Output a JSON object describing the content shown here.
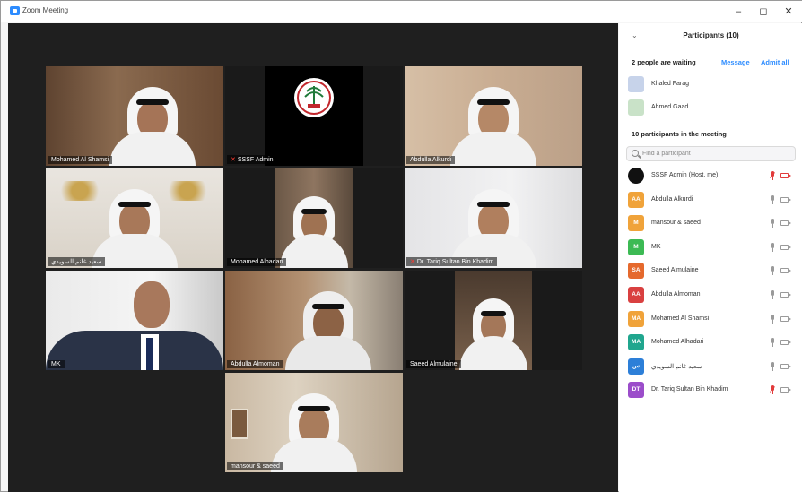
{
  "window": {
    "title": "Zoom Meeting",
    "minimize": "–",
    "restore": "◻",
    "close": "✕"
  },
  "gallery": {
    "tiles": [
      {
        "name": "Mohamed Al Shamsi",
        "mic_muted": false
      },
      {
        "name": "SSSF Admin",
        "mic_muted": true
      },
      {
        "name": "Abdulla Alkurdi",
        "mic_muted": false,
        "active_speaker": true
      },
      {
        "name": "سعيد غانم السويدي",
        "mic_muted": false
      },
      {
        "name": "Mohamed Alhadari",
        "mic_muted": false
      },
      {
        "name": "Dr. Tariq Sultan Bin Khadim",
        "mic_muted": true
      },
      {
        "name": "MK",
        "mic_muted": false
      },
      {
        "name": "Abdulla Almoman",
        "mic_muted": false
      },
      {
        "name": "Saeed Almulaine",
        "mic_muted": false
      },
      {
        "name": "mansour & saeed",
        "mic_muted": false
      }
    ]
  },
  "participants_panel": {
    "title": "Participants (10)",
    "waiting_label": "2 people are waiting",
    "message_label": "Message",
    "admit_all_label": "Admit all",
    "waiting": [
      {
        "name": "Khaled Farag",
        "initials": "KF",
        "color": "#c7d3ea"
      },
      {
        "name": "Ahmed Gaad",
        "initials": "AG",
        "color": "#c9e2c8"
      }
    ],
    "in_meeting_label": "10 participants in the meeting",
    "search_placeholder": "Find a participant",
    "participants": [
      {
        "name": "SSSF Admin (Host, me)",
        "initials": "",
        "color": "#111111",
        "mic": "muted",
        "video": "off"
      },
      {
        "name": "Abdulla Alkurdi",
        "initials": "AA",
        "color": "#f0a33a",
        "mic": "on",
        "video": "on"
      },
      {
        "name": "mansour & saeed",
        "initials": "M",
        "color": "#f0a33a",
        "mic": "on",
        "video": "on"
      },
      {
        "name": "MK",
        "initials": "M",
        "color": "#3cba54",
        "mic": "on",
        "video": "on"
      },
      {
        "name": "Saeed Almulaine",
        "initials": "SA",
        "color": "#e5692d",
        "mic": "on",
        "video": "on"
      },
      {
        "name": "Abdulla Almoman",
        "initials": "AA",
        "color": "#d94040",
        "mic": "on",
        "video": "on"
      },
      {
        "name": "Mohamed Al Shamsi",
        "initials": "MA",
        "color": "#f0a33a",
        "mic": "on",
        "video": "on"
      },
      {
        "name": "Mohamed Alhadari",
        "initials": "MA",
        "color": "#20a68e",
        "mic": "on",
        "video": "on"
      },
      {
        "name": "سعيد غانم السويدي",
        "initials": "س",
        "color": "#2d7fd8",
        "mic": "on",
        "video": "on"
      },
      {
        "name": "Dr. Tariq Sultan Bin Khadim",
        "initials": "DT",
        "color": "#9b4dca",
        "mic": "muted",
        "video": "on"
      }
    ]
  }
}
